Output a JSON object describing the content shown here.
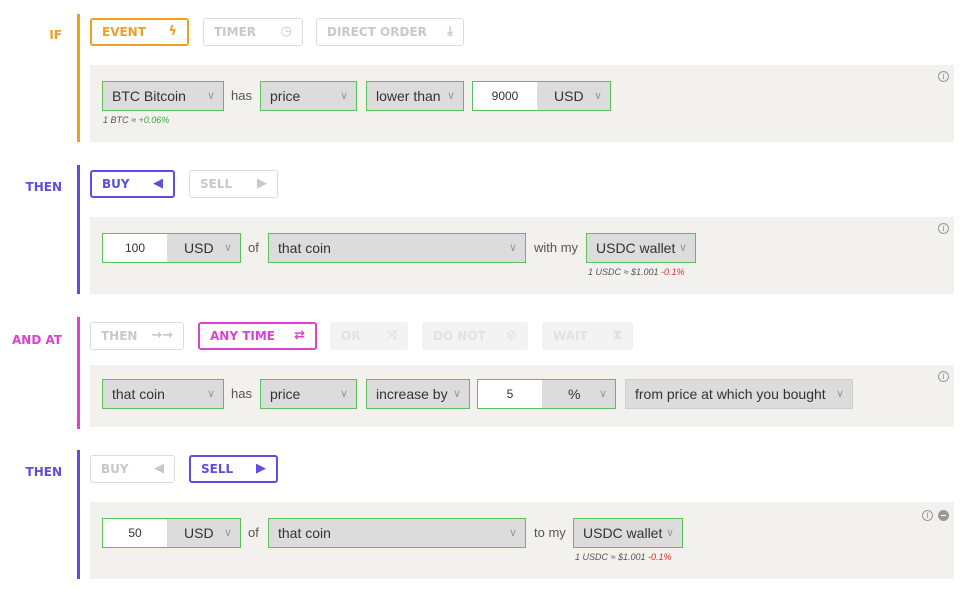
{
  "colors": {
    "if": "#f0a020",
    "then": "#5b4ee0",
    "andat": "#e040d0",
    "valid": "#5cbf5c"
  },
  "sec1": {
    "label": "IF",
    "tabs": {
      "event": "EVENT",
      "timer": "TIMER",
      "direct": "DIRECT ORDER"
    },
    "coin": "BTC Bitcoin",
    "has": "has",
    "metric": "price",
    "cond": "lower than",
    "amount": "9000",
    "currency": "USD",
    "note": "1 BTC ≈",
    "note_change": "+0.06%"
  },
  "sec2": {
    "label": "THEN",
    "tabs": {
      "buy": "BUY",
      "sell": "SELL"
    },
    "amount": "100",
    "currency": "USD",
    "of": "of",
    "target": "that coin",
    "with": "with my",
    "wallet": "USDC wallet",
    "note": "1 USDC ≈ $1.001",
    "note_change": "-0.1%"
  },
  "sec3": {
    "label": "AND AT",
    "tabs": {
      "then": "THEN",
      "anytime": "ANY TIME",
      "or": "OR",
      "donot": "DO NOT",
      "wait": "WAIT"
    },
    "coin": "that coin",
    "has": "has",
    "metric": "price",
    "cond": "increase by",
    "amount": "5",
    "unit": "%",
    "ref": "from price at which you bought"
  },
  "sec4": {
    "label": "THEN",
    "tabs": {
      "buy": "BUY",
      "sell": "SELL"
    },
    "amount": "50",
    "currency": "USD",
    "of": "of",
    "target": "that coin",
    "to": "to my",
    "wallet": "USDC wallet",
    "note": "1 USDC ≈ $1.001",
    "note_change": "-0.1%"
  }
}
